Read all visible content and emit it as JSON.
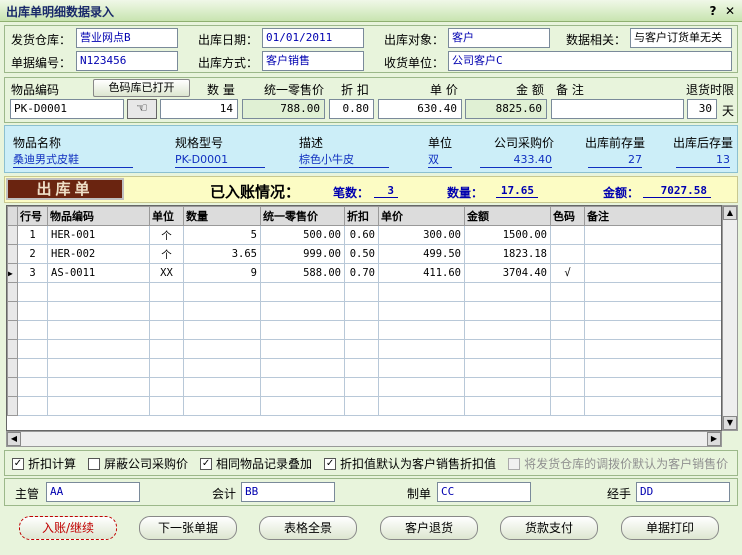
{
  "window": {
    "title": "出库单明细数据录入",
    "help": "?",
    "close": "✕"
  },
  "header": {
    "warehouse_label": "发货仓库：",
    "warehouse": "营业网点B",
    "date_label": "出库日期：",
    "date": "01/01/2011",
    "target_label": "出库对象：",
    "target": "客户",
    "related_label": "数据相关：",
    "related": "与客户订货单无关",
    "docno_label": "单据编号：",
    "docno": "N123456",
    "method_label": "出库方式：",
    "method": "客户销售",
    "receiver_label": "收货单位：",
    "receiver": "公司客户C"
  },
  "entry": {
    "code_label": "物品编码",
    "color_btn": "色码库已打开",
    "qty_label": "数 量",
    "retail_label": "统一零售价",
    "discount_label": "折 扣",
    "price_label": "单 价",
    "amount_label": "金 额",
    "note_label": "备 注",
    "return_label": "退货时限",
    "code": "PK-D0001",
    "qty": "14",
    "retail": "788.00",
    "discount": "0.80",
    "price": "630.40",
    "amount": "8825.60",
    "note": "",
    "return_days": "30",
    "day_unit": "天"
  },
  "info": {
    "headers": [
      "物品名称",
      "规格型号",
      "描述",
      "单位",
      "公司采购价",
      "出库前存量",
      "出库后存量"
    ],
    "values": [
      "桑迪男式皮鞋",
      "PK-D0001",
      "棕色小牛皮",
      "双",
      "433.40",
      "27",
      "13"
    ]
  },
  "summary": {
    "logo": "出库单",
    "heading": "已入账情况：",
    "count_label": "笔数：",
    "count": "3",
    "qty_label": "数量：",
    "qty": "17.65",
    "amount_label": "金额：",
    "amount": "7027.58"
  },
  "table": {
    "columns": [
      "行号",
      "物品编码",
      "单位",
      "数量",
      "统一零售价",
      "折扣",
      "单价",
      "金额",
      "色码",
      "备注"
    ],
    "rows": [
      [
        "1",
        "HER-001",
        "个",
        "5",
        "500.00",
        "0.60",
        "300.00",
        "1500.00",
        "",
        ""
      ],
      [
        "2",
        "HER-002",
        "个",
        "3.65",
        "999.00",
        "0.50",
        "499.50",
        "1823.18",
        "",
        ""
      ],
      [
        "3",
        "AS-0011",
        "XX",
        "9",
        "588.00",
        "0.70",
        "411.60",
        "3704.40",
        "√",
        ""
      ]
    ],
    "current_marker": "▶"
  },
  "options": [
    {
      "label": "折扣计算",
      "checked": true,
      "disabled": false
    },
    {
      "label": "屏蔽公司采购价",
      "checked": false,
      "disabled": false
    },
    {
      "label": "相同物品记录叠加",
      "checked": true,
      "disabled": false
    },
    {
      "label": "折扣值默认为客户销售折扣值",
      "checked": true,
      "disabled": false
    },
    {
      "label": "将发货仓库的调拨价默认为客户销售价",
      "checked": false,
      "disabled": true
    }
  ],
  "footer": {
    "manager_label": "主管",
    "manager": "AA",
    "accountant_label": "会计",
    "accountant": "BB",
    "maker_label": "制单",
    "maker": "CC",
    "handler_label": "经手",
    "handler": "DD"
  },
  "buttons": [
    "入账/继续",
    "下一张单据",
    "表格全景",
    "客户退货",
    "货款支付",
    "单据打印"
  ]
}
